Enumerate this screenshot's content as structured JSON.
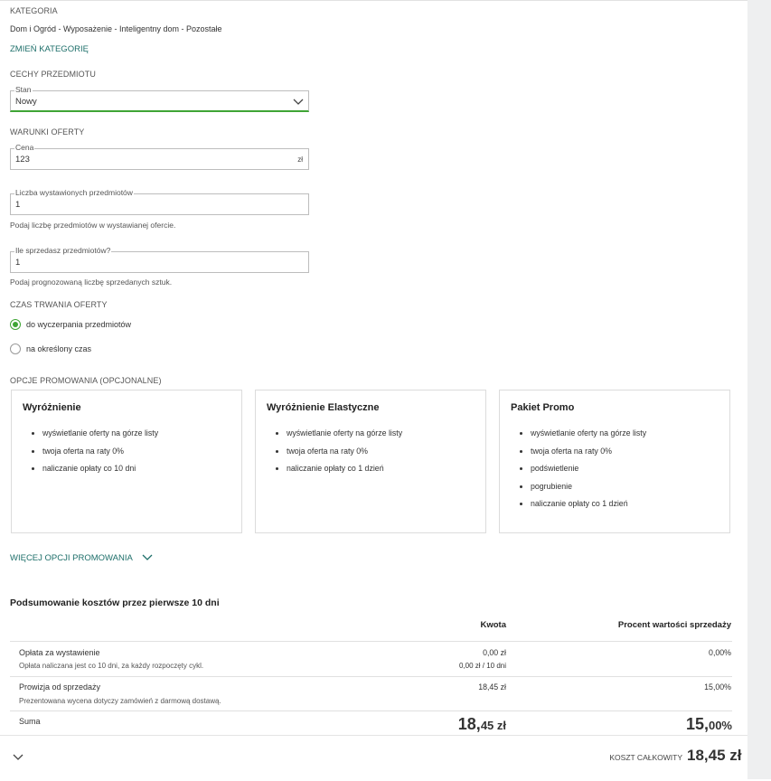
{
  "category": {
    "header": "KATEGORIA",
    "path": "Dom i Ogród - Wyposażenie - Inteligentny dom - Pozostałe",
    "change_link": "ZMIEŃ KATEGORIĘ"
  },
  "features": {
    "header": "CECHY PRZEDMIOTU",
    "condition": {
      "label": "Stan",
      "value": "Nowy"
    }
  },
  "offer_terms": {
    "header": "WARUNKI OFERTY",
    "price": {
      "label": "Cena",
      "value": "123",
      "unit": "zł"
    },
    "quantity": {
      "label": "Liczba wystawionych przedmiotów",
      "value": "1",
      "help": "Podaj liczbę przedmiotów w wystawianej ofercie."
    },
    "expected_sales": {
      "label": "Ile sprzedasz przedmiotów?",
      "value": "1",
      "help": "Podaj prognozowaną liczbę sprzedanych sztuk."
    }
  },
  "duration": {
    "header": "CZAS TRWANIA OFERTY",
    "options": [
      {
        "label": "do wyczerpania przedmiotów",
        "selected": true
      },
      {
        "label": "na określony czas",
        "selected": false
      }
    ]
  },
  "promo": {
    "header": "OPCJE PROMOWANIA (OPCJONALNE)",
    "cards": [
      {
        "title": "Wyróżnienie",
        "items": [
          "wyświetlanie oferty na górze listy",
          "twoja oferta na raty 0%",
          "naliczanie opłaty co 10 dni"
        ]
      },
      {
        "title": "Wyróżnienie Elastyczne",
        "items": [
          "wyświetlanie oferty na górze listy",
          "twoja oferta na raty 0%",
          "naliczanie opłaty co 1 dzień"
        ]
      },
      {
        "title": "Pakiet Promo",
        "items": [
          "wyświetlanie oferty na górze listy",
          "twoja oferta na raty 0%",
          "podświetlenie",
          "pogrubienie",
          "naliczanie opłaty co 1 dzień"
        ]
      }
    ],
    "more_link": "WIĘCEJ OPCJI PROMOWANIA"
  },
  "summary": {
    "title": "Podsumowanie kosztów przez pierwsze 10 dni",
    "col_amount": "Kwota",
    "col_percent": "Procent wartości sprzedaży",
    "rows": [
      {
        "label": "Opłata za wystawienie",
        "sub": "Opłata naliczana jest co 10 dni, za każdy rozpoczęty cykl.",
        "amount": "0,00 zł",
        "amount_sub": "0,00 zł / 10 dni",
        "percent": "0,00%"
      },
      {
        "label": "Prowizja od sprzedaży",
        "sub": "Prezentowana wycena dotyczy zamówień z darmową dostawą.",
        "amount": "18,45 zł",
        "amount_sub": "",
        "percent": "15,00%"
      }
    ],
    "total": {
      "label": "Suma",
      "amount_main": "18,",
      "amount_dec": "45 zł",
      "percent_main": "15,",
      "percent_dec": "00%"
    }
  },
  "footer": {
    "total_label": "KOSZT CAŁKOWITY",
    "total_value": "18,45 zł"
  },
  "colors": {
    "accent": "#3fa535",
    "link": "#1e6f6a"
  },
  "icons": {
    "dropdown": "chevron-down-icon",
    "more": "chevron-down-icon",
    "footer_toggle": "chevron-down-icon"
  }
}
